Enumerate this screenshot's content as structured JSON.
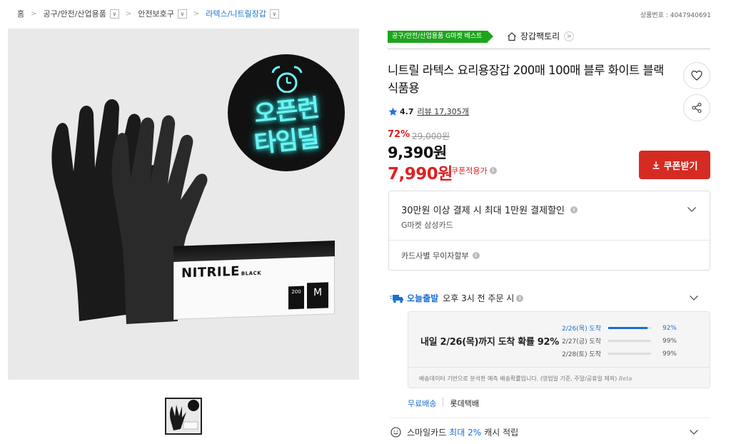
{
  "breadcrumb": {
    "items": [
      "홈",
      "공구/안전/산업용품",
      "안전보호구",
      "라텍스/니트릴장갑"
    ]
  },
  "product_no": "상품번호 : 4047940691",
  "image": {
    "badge_line1": "오픈런",
    "badge_line2": "타임딜",
    "box_brand": "NITRILE",
    "box_brand_sub": "BLACK",
    "box_size": "M",
    "box_count": "200"
  },
  "tag_best": "공구/안전/산업용품 G마켓 베스트",
  "store_name": "장갑팩토리",
  "title": "니트릴 라텍스 요리용장갑 200매 100매 블루 화이트 블랙 식품용",
  "rating": {
    "score": "4.7",
    "review": "리뷰 17,305개"
  },
  "price": {
    "discount": "72%",
    "original": "29,000원",
    "sale": "9,390원",
    "coupon": "7,990원",
    "coupon_label": "쿠폰적용가"
  },
  "coupon_button": "쿠폰받기",
  "card_promo": {
    "headline": "30만원 이상 결제 시 최대 1만원 결제할인",
    "card_name": "G마켓 삼성카드",
    "installment": "카드사별 무이자할부"
  },
  "shipping": {
    "today_label": "오늘출발",
    "cutoff": "오후 3시 전 주문 시",
    "main_msg": "내일 2/26(목)까지 도착 확률 92%",
    "rows": [
      {
        "date": "2/26(목) 도착",
        "pct": "92%",
        "value": 0.92
      },
      {
        "date": "2/27(금) 도착",
        "pct": "99%",
        "value": 0.99
      },
      {
        "date": "2/28(토) 도착",
        "pct": "99%",
        "value": 0.99
      }
    ],
    "note": "배송데이터 기반으로 분석한 예측 배송확률입니다. (영업일 기준, 주말/공휴일 제외)",
    "beta": "Beta",
    "free_label": "무료배송",
    "carrier": "롯데택배"
  },
  "smile": {
    "prefix": "스마일카드",
    "highlight": "최대 2%",
    "suffix": "캐시 적립"
  },
  "colors": {
    "accent_red": "#d52b23",
    "accent_blue": "#1a6fd1",
    "best_green": "#1da51d"
  }
}
